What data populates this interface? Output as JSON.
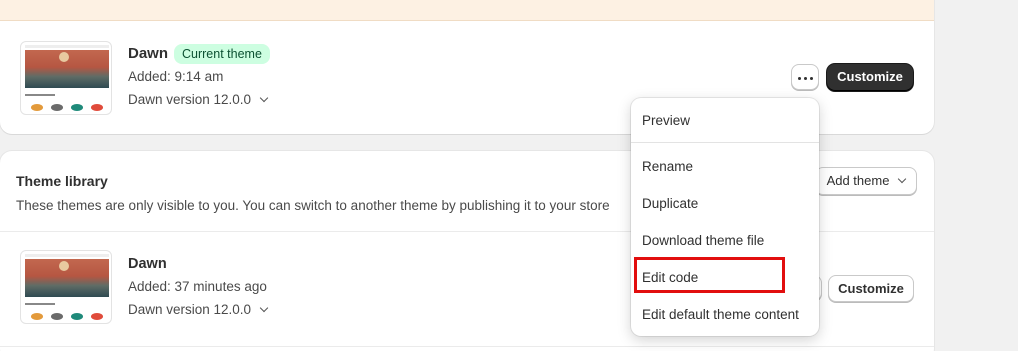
{
  "current_theme": {
    "name": "Dawn",
    "badge": "Current theme",
    "added": "Added: 9:14 am",
    "version": "Dawn version 12.0.0",
    "customize_label": "Customize"
  },
  "theme_library": {
    "title": "Theme library",
    "description": "These themes are only visible to you. You can switch to another theme by publishing it to your store",
    "add_theme_label": "Add theme",
    "themes": [
      {
        "name": "Dawn",
        "added": "Added: 37 minutes ago",
        "version": "Dawn version 12.0.0",
        "customize_label": "Customize"
      }
    ]
  },
  "actions_menu": {
    "items": [
      "Preview",
      "Rename",
      "Duplicate",
      "Download theme file",
      "Edit code",
      "Edit default theme content"
    ],
    "highlighted": "Edit code"
  },
  "colors": {
    "primary_button": "#303030",
    "badge_bg": "#cdfee1",
    "badge_text": "#0c5132",
    "highlight": "#e20e0e",
    "banner_bg": "#fdf1e3"
  },
  "thumbnail_dot_colors": [
    "#e39a3b",
    "#6b6b6b",
    "#1f8a7a",
    "#e04b3b"
  ]
}
